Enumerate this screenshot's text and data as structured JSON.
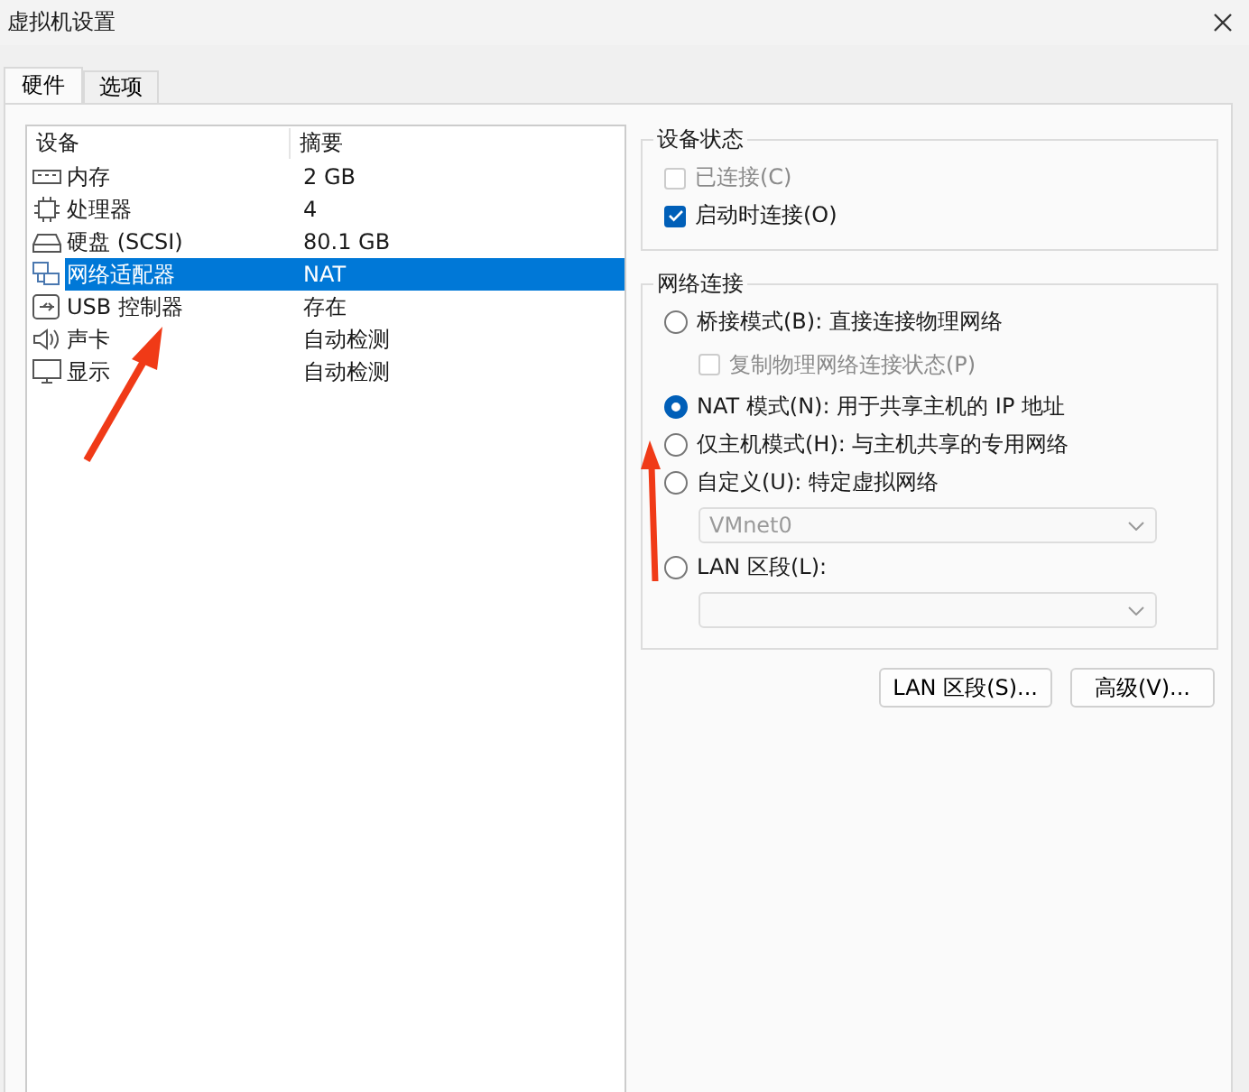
{
  "window": {
    "title": "虚拟机设置"
  },
  "tabs": [
    {
      "label": "硬件",
      "selected": true
    },
    {
      "label": "选项",
      "selected": false
    }
  ],
  "devices": {
    "columns": [
      "设备",
      "摘要"
    ],
    "rows": [
      {
        "kind": "memory",
        "name": "内存",
        "summary": "2 GB",
        "selected": false
      },
      {
        "kind": "cpu",
        "name": "处理器",
        "summary": "4",
        "selected": false
      },
      {
        "kind": "disk",
        "name": "硬盘 (SCSI)",
        "summary": "80.1 GB",
        "selected": false
      },
      {
        "kind": "network",
        "name": "网络适配器",
        "summary": "NAT",
        "selected": true
      },
      {
        "kind": "usb",
        "name": "USB 控制器",
        "summary": "存在",
        "selected": false
      },
      {
        "kind": "sound",
        "name": "声卡",
        "summary": "自动检测",
        "selected": false
      },
      {
        "kind": "display",
        "name": "显示",
        "summary": "自动检测",
        "selected": false
      }
    ]
  },
  "device_status": {
    "title": "设备状态",
    "items": [
      {
        "kind": "checkbox",
        "label": "已连接(C)",
        "checked": false,
        "disabled": true
      },
      {
        "kind": "checkbox",
        "label": "启动时连接(O)",
        "checked": true,
        "disabled": false
      }
    ]
  },
  "network_connection": {
    "title": "网络连接",
    "items": [
      {
        "kind": "radio",
        "label": "桥接模式(B): 直接连接物理网络",
        "selected": false,
        "children": [
          {
            "kind": "checkbox",
            "label": "复制物理网络连接状态(P)",
            "checked": false,
            "disabled": true
          }
        ]
      },
      {
        "kind": "radio",
        "label": "NAT 模式(N): 用于共享主机的 IP 地址",
        "selected": true
      },
      {
        "kind": "radio",
        "label": "仅主机模式(H): 与主机共享的专用网络",
        "selected": false
      },
      {
        "kind": "radio",
        "label": "自定义(U): 特定虚拟网络",
        "selected": false,
        "children": [
          {
            "kind": "select",
            "value": "VMnet0",
            "disabled": true
          }
        ]
      },
      {
        "kind": "radio",
        "label": "LAN 区段(L):",
        "selected": false,
        "children": [
          {
            "kind": "select",
            "disabled": true
          }
        ]
      }
    ]
  },
  "buttons": [
    "LAN 区段(S)...",
    "高级(V)..."
  ]
}
